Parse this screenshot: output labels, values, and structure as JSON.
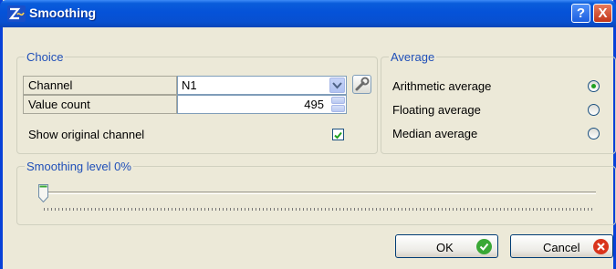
{
  "window": {
    "title": "Smoothing",
    "help_label": "?",
    "close_label": "X"
  },
  "choice": {
    "group_label": "Choice",
    "channel_label": "Channel",
    "channel_value": "N1",
    "value_count_label": "Value count",
    "value_count_value": "495",
    "show_original_label": "Show original channel",
    "show_original_checked": true
  },
  "average": {
    "group_label": "Average",
    "options": [
      {
        "label": "Arithmetic average",
        "selected": true
      },
      {
        "label": "Floating average",
        "selected": false
      },
      {
        "label": "Median average",
        "selected": false
      }
    ]
  },
  "smoothing": {
    "group_label": "Smoothing level  0%",
    "level_percent": 0
  },
  "buttons": {
    "ok_label": "OK",
    "cancel_label": "Cancel"
  },
  "colors": {
    "title_bar": "#0552d8",
    "group_label": "#1f4fb8",
    "ok_icon": "#3aa836",
    "cancel_icon": "#d9341c"
  }
}
